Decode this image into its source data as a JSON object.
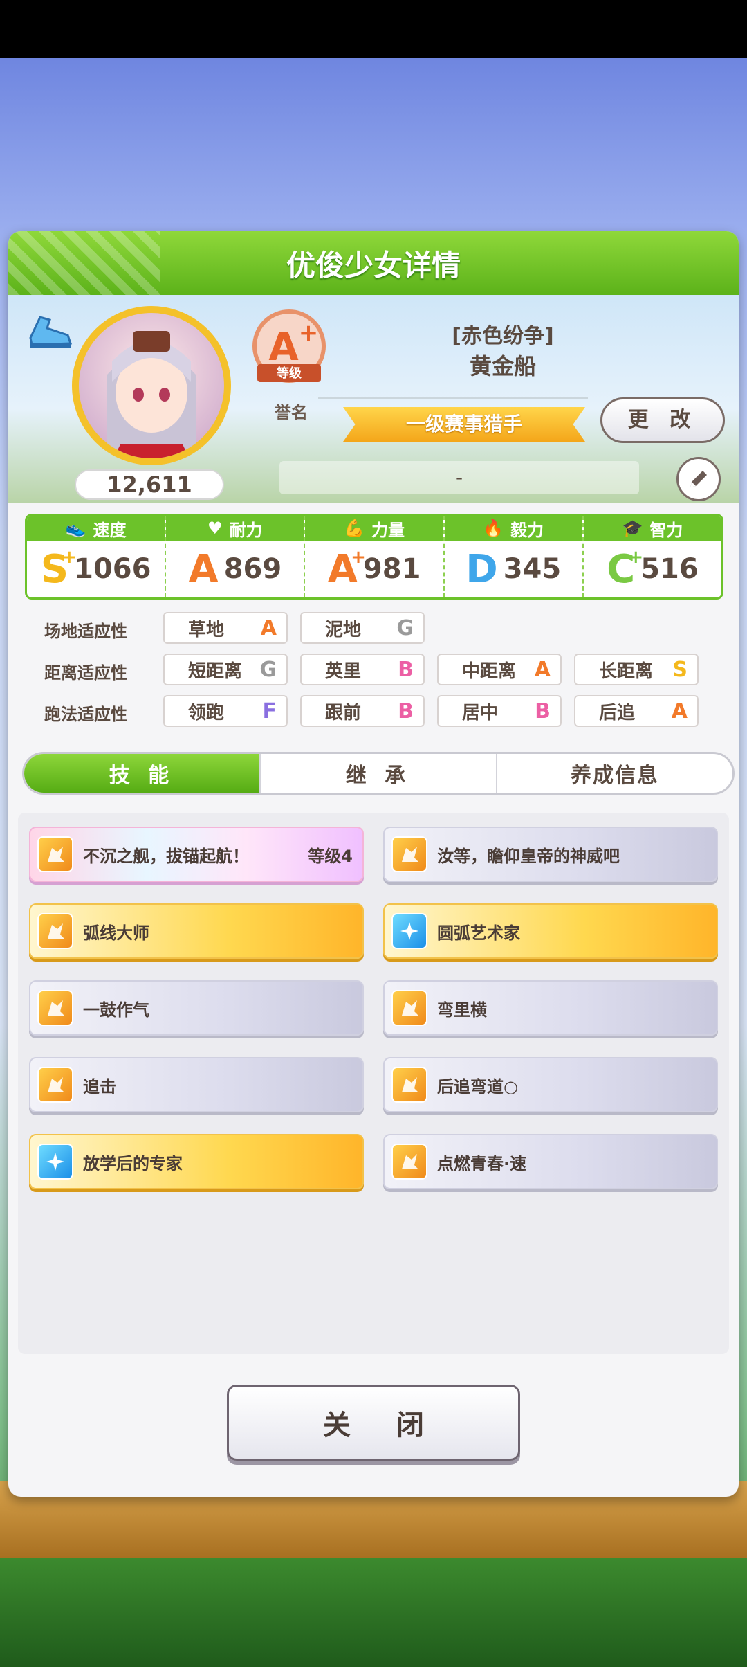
{
  "panel": {
    "title": "优俊少女详情"
  },
  "profile": {
    "fans": "12,611",
    "rank": {
      "letter": "A",
      "plus": "+",
      "sublabel": "等级",
      "label": "誉名"
    },
    "epithet": "[赤色纷争]",
    "name": "黄金船",
    "title": "一级赛事猎手",
    "change_label": "更 改",
    "comment": "-"
  },
  "stats": [
    {
      "name": "速度",
      "icon": "shoe-icon",
      "grade": "S",
      "plus": "+",
      "value": "1066",
      "color": "#f4b81c"
    },
    {
      "name": "耐力",
      "icon": "heart-icon",
      "grade": "A",
      "plus": "",
      "value": "869",
      "color": "#f27a2a"
    },
    {
      "name": "力量",
      "icon": "muscle-icon",
      "grade": "A",
      "plus": "+",
      "value": "981",
      "color": "#f27a2a"
    },
    {
      "name": "毅力",
      "icon": "flame-icon",
      "grade": "D",
      "plus": "",
      "value": "345",
      "color": "#3fa6ea"
    },
    {
      "name": "智力",
      "icon": "graduation-cap-icon",
      "grade": "C",
      "plus": "+",
      "value": "516",
      "color": "#7ac943"
    }
  ],
  "aptitude": {
    "track": {
      "label": "场地适应性",
      "items": [
        {
          "name": "草地",
          "grade": "A"
        },
        {
          "name": "泥地",
          "grade": "G"
        }
      ]
    },
    "distance": {
      "label": "距离适应性",
      "items": [
        {
          "name": "短距离",
          "grade": "G"
        },
        {
          "name": "英里",
          "grade": "B"
        },
        {
          "name": "中距离",
          "grade": "A"
        },
        {
          "name": "长距离",
          "grade": "S"
        }
      ]
    },
    "style": {
      "label": "跑法适应性",
      "items": [
        {
          "name": "领跑",
          "grade": "F"
        },
        {
          "name": "跟前",
          "grade": "B"
        },
        {
          "name": "居中",
          "grade": "B"
        },
        {
          "name": "后追",
          "grade": "A"
        }
      ]
    }
  },
  "grade_colors": {
    "S": "#f4b81c",
    "A": "#f27a2a",
    "B": "#ec5fa4",
    "C": "#7ac943",
    "D": "#3fa6ea",
    "F": "#8a6fe0",
    "G": "#9a9a9a"
  },
  "tabs": [
    {
      "label": "技 能",
      "active": true
    },
    {
      "label": "继 承",
      "active": false
    },
    {
      "label": "养成信息",
      "active": false
    }
  ],
  "skills": [
    {
      "name": "不沉之舰，拔锚起航！",
      "level": "等级4",
      "style": "rainbow",
      "icon": "orange"
    },
    {
      "name": "汝等，瞻仰皇帝的神威吧",
      "level": "",
      "style": "normal",
      "icon": "orange"
    },
    {
      "name": "弧线大师",
      "level": "",
      "style": "gold",
      "icon": "orange"
    },
    {
      "name": "圆弧艺术家",
      "level": "",
      "style": "gold",
      "icon": "blue"
    },
    {
      "name": "一鼓作气",
      "level": "",
      "style": "normal",
      "icon": "orange"
    },
    {
      "name": "弯里横",
      "level": "",
      "style": "normal",
      "icon": "orange"
    },
    {
      "name": "追击",
      "level": "",
      "style": "normal",
      "icon": "orange"
    },
    {
      "name": "后追弯道○",
      "level": "",
      "style": "normal",
      "icon": "orange"
    },
    {
      "name": "放学后的专家",
      "level": "",
      "style": "gold",
      "icon": "blue"
    },
    {
      "name": "点燃青春·速",
      "level": "",
      "style": "normal",
      "icon": "orange"
    }
  ],
  "close_label": "关 闭"
}
